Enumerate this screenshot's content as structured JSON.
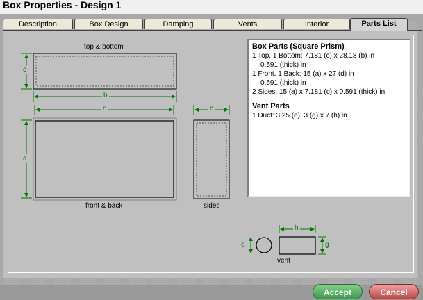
{
  "window": {
    "title": "Box Properties - Design 1"
  },
  "tabs": [
    {
      "label": "Description",
      "active": false
    },
    {
      "label": "Box Design",
      "active": false
    },
    {
      "label": "Damping",
      "active": false
    },
    {
      "label": "Vents",
      "active": false
    },
    {
      "label": "Interior",
      "active": false
    },
    {
      "label": "Parts List",
      "active": true
    }
  ],
  "diagram": {
    "top_bottom_label": "top & bottom",
    "front_back_label": "front & back",
    "sides_label": "sides",
    "vent_label": "vent",
    "dims": {
      "a": "a",
      "b": "b",
      "c": "c",
      "d": "d",
      "e": "e",
      "g": "g",
      "h": "h"
    }
  },
  "parts": {
    "box_heading": "Box Parts (Square Prism)",
    "box_lines": [
      "1 Top, 1 Bottom:  7.181 (c) x 28.18 (b) in",
      "0.591 (thick) in",
      "1 Front, 1 Back:  15 (a) x 27 (d) in",
      "0.591 (thick) in",
      "2 Sides:  15 (a) x 7.181 (c) x 0.591 (thick) in"
    ],
    "vent_heading": "Vent Parts",
    "vent_lines": [
      "1 Duct:  3.25 (e), 3 (g) x 7 (h) in"
    ]
  },
  "buttons": {
    "accept": "Accept",
    "cancel": "Cancel"
  },
  "colors": {
    "dimension": "#007a00",
    "panel": "#c0c0c0",
    "accept": "#3f9a4c",
    "cancel": "#c04848"
  }
}
